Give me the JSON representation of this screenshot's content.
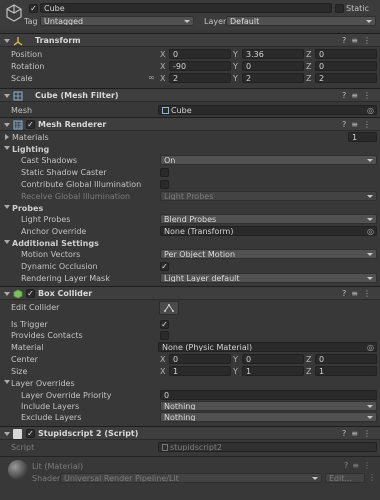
{
  "object": {
    "name": "Cube",
    "static_label": "Static",
    "tag_label": "Tag",
    "tag_value": "Untagged",
    "layer_label": "Layer",
    "layer_value": "Default"
  },
  "transform": {
    "title": "Transform",
    "position_label": "Position",
    "rotation_label": "Rotation",
    "scale_label": "Scale",
    "position": {
      "x": "0",
      "y": "3.36",
      "z": "0"
    },
    "rotation": {
      "x": "-90",
      "y": "0",
      "z": "0"
    },
    "scale": {
      "x": "2",
      "y": "2",
      "z": "2"
    },
    "axis_x": "X",
    "axis_y": "Y",
    "axis_z": "Z"
  },
  "mesh_filter": {
    "title": "Cube (Mesh Filter)",
    "mesh_label": "Mesh",
    "mesh_value": "Cube"
  },
  "mesh_renderer": {
    "title": "Mesh Renderer",
    "materials_label": "Materials",
    "materials_count": "1",
    "lighting_label": "Lighting",
    "cast_shadows_label": "Cast Shadows",
    "cast_shadows_value": "On",
    "static_shadow_caster_label": "Static Shadow Caster",
    "contribute_gi_label": "Contribute Global Illumination",
    "receive_gi_label": "Receive Global Illumination",
    "receive_gi_value": "Light Probes",
    "probes_label": "Probes",
    "light_probes_label": "Light Probes",
    "light_probes_value": "Blend Probes",
    "anchor_override_label": "Anchor Override",
    "anchor_override_value": "None (Transform)",
    "additional_label": "Additional Settings",
    "motion_vectors_label": "Motion Vectors",
    "motion_vectors_value": "Per Object Motion",
    "dynamic_occlusion_label": "Dynamic Occlusion",
    "rendering_layer_label": "Rendering Layer Mask",
    "rendering_layer_value": "Light Layer default"
  },
  "box_collider": {
    "title": "Box Collider",
    "edit_collider_label": "Edit Collider",
    "is_trigger_label": "Is Trigger",
    "provides_contacts_label": "Provides Contacts",
    "material_label": "Material",
    "material_value": "None (Physic Material)",
    "center_label": "Center",
    "center": {
      "x": "0",
      "y": "0",
      "z": "0"
    },
    "size_label": "Size",
    "size": {
      "x": "1",
      "y": "1",
      "z": "1"
    },
    "layer_overrides_label": "Layer Overrides",
    "priority_label": "Layer Override Priority",
    "priority_value": "0",
    "include_label": "Include Layers",
    "include_value": "Nothing",
    "exclude_label": "Exclude Layers",
    "exclude_value": "Nothing"
  },
  "script": {
    "title": "Stupidscript 2 (Script)",
    "script_label": "Script",
    "script_value": "stupidscript2"
  },
  "material": {
    "title": "Lit (Material)",
    "shader_label": "Shader",
    "shader_value": "Universal Render Pipeline/Lit",
    "edit_label": "Edit..."
  }
}
